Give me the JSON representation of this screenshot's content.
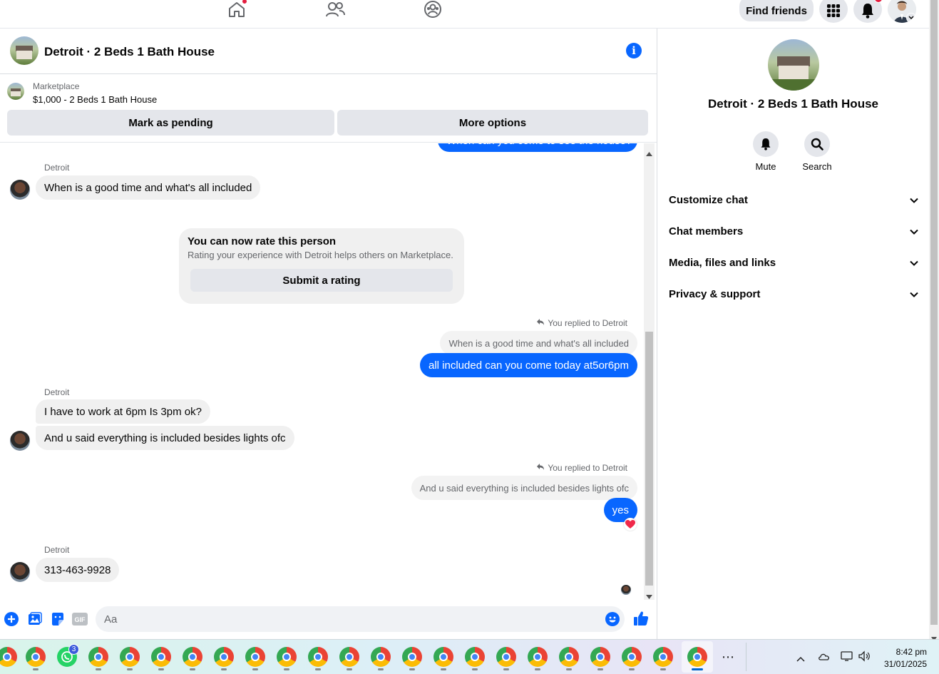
{
  "topnav": {
    "find_friends": "Find friends"
  },
  "chat": {
    "title": "Detroit · 2 Beds 1 Bath House"
  },
  "marketplace": {
    "label": "Marketplace",
    "listing": "$1,000 - 2 Beds 1 Bath House",
    "mark_pending": "Mark as pending",
    "more_options": "More options"
  },
  "messages": {
    "top_partial": "When can you come to see the house?",
    "m1_sender": "Detroit",
    "m1_text": "When is a good time and what's all included",
    "rate": {
      "title": "You can now rate this person",
      "desc": "Rating your experience with Detroit helps others on Marketplace.",
      "button": "Submit a rating"
    },
    "r1_note": "You replied to Detroit",
    "r1_quote": "When is a good time and what's all included",
    "r1_text": "all included can you come today at5or6pm",
    "m2_sender": "Detroit",
    "m2_text1": "I have to work at 6pm Is 3pm ok?",
    "m2_text2": "And u said everything is included besides lights ofc",
    "r2_note": "You replied to Detroit",
    "r2_quote": "And u said everything is included besides lights ofc",
    "r2_text": "yes",
    "m3_sender": "Detroit",
    "m3_text": "313-463-9928"
  },
  "composer": {
    "placeholder": "Aa"
  },
  "right_panel": {
    "title": "Detroit · 2 Beds 1 Bath House",
    "mute": "Mute",
    "search": "Search",
    "rows": [
      "Customize chat",
      "Chat members",
      "Media, files and links",
      "Privacy & support"
    ]
  },
  "taskbar": {
    "time": "8:42 pm",
    "date": "31/01/2025",
    "whatsapp_badge": "3"
  },
  "colors": {
    "accent": "#0866ff",
    "bubble_in": "#f0f0f0",
    "notification": "#e41e3f"
  },
  "icons": [
    "home-icon",
    "friends-icon",
    "groups-icon",
    "apps-grid-icon",
    "bell-icon",
    "info-icon",
    "reply-icon",
    "heart-reaction-icon",
    "plus-icon",
    "photo-icon",
    "sticker-icon",
    "gif-icon",
    "emoji-icon",
    "like-icon",
    "chevron-down-icon",
    "search-icon"
  ]
}
